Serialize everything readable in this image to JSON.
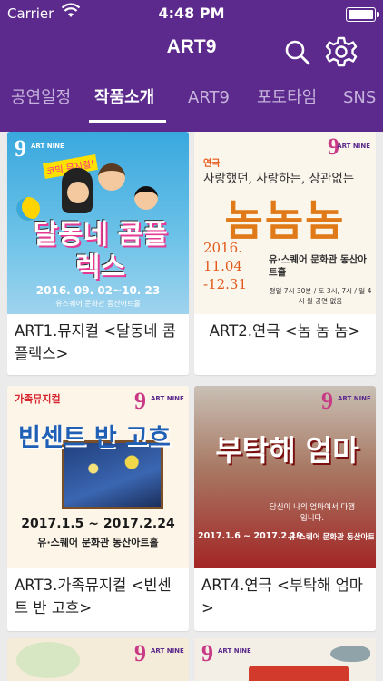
{
  "status": {
    "carrier": "Carrier",
    "time": "4:48 PM"
  },
  "header": {
    "title": "ART9",
    "search_icon": "search-icon",
    "settings_icon": "gear-icon"
  },
  "tabs": [
    {
      "label": "공연일정",
      "active": false
    },
    {
      "label": "작품소개",
      "active": true
    },
    {
      "label": "ART9",
      "active": false
    },
    {
      "label": "포토타임",
      "active": false
    },
    {
      "label": "SNS",
      "active": false
    }
  ],
  "cards": [
    {
      "caption": "ART1.뮤지컬 <달동네 콤플렉스>",
      "poster": {
        "brand": "ART NINE",
        "tag": "코믹 뮤지컬!",
        "title": "달동네 콤플렉스",
        "dates": "2016. 09. 02~10. 23",
        "venue": "유스퀘어 문화관 동산아트홀"
      }
    },
    {
      "caption": "ART2.연극 <놈 놈 놈>",
      "poster": {
        "brand": "ART NINE",
        "genre": "연극",
        "tagline": "사랑했던, 사랑하는, 상관없는",
        "title": "놈놈놈",
        "dates": "2016. 11.04 -12.31",
        "venue": "유·스퀘어 문화관 동산아트홀",
        "schedule": "평일 7시 30분 / 토 3시, 7시 / 일 4시 월 공연 없음"
      }
    },
    {
      "caption": "ART3.가족뮤지컬 <빈센트 반 고흐>",
      "poster": {
        "brand": "ART NINE",
        "genre": "가족뮤지컬",
        "title": "빈센트 반 고흐",
        "dates": "2017.1.5 ~ 2017.2.24",
        "venue": "유·스퀘어 문화관 동산아트홀"
      }
    },
    {
      "caption": "ART4.연극 <부탁해 엄마>",
      "poster": {
        "brand": "ART NINE",
        "title": "부탁해 엄마",
        "quote": "당신이 나의 엄마여서 다행입니다.",
        "dates": "2017.1.6 ~ 2017.2.19",
        "venue": "유·스퀘어 문화관 동산아트홀"
      }
    },
    {
      "caption": "",
      "poster": {
        "brand": "ART NINE"
      }
    },
    {
      "caption": "",
      "poster": {
        "brand": "ART NINE"
      }
    }
  ]
}
